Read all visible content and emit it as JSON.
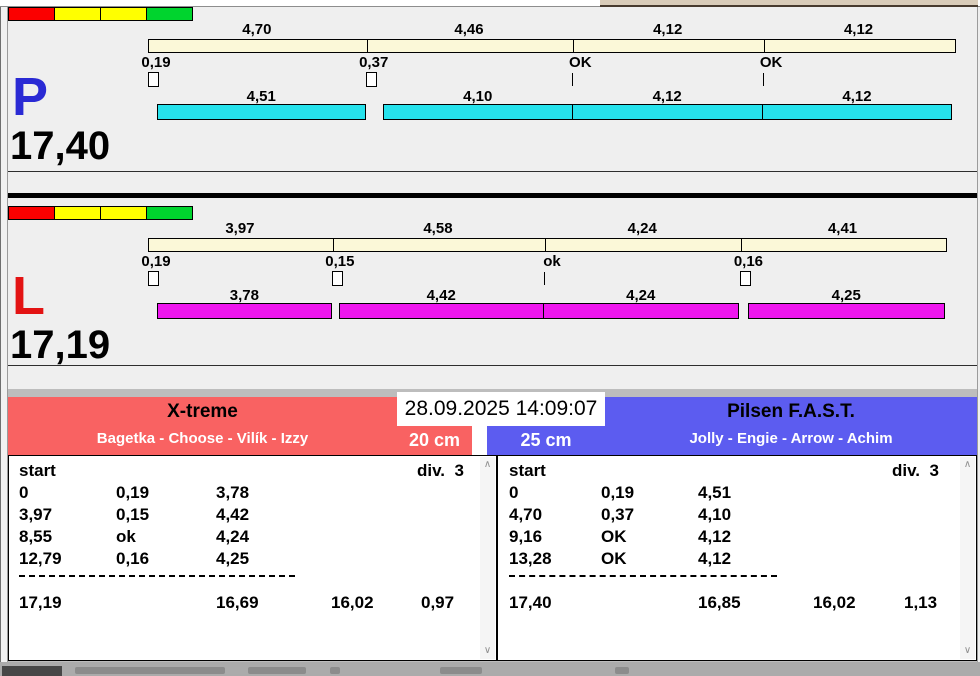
{
  "status_lights": [
    "#fb0000",
    "#ffff00",
    "#ffff00",
    "#00d42e"
  ],
  "datetime": "28.09.2025 14:09:07",
  "lanes": [
    {
      "letter": "P",
      "letter_color": "#2a2ad4",
      "leg_color": "#26e2ec",
      "total": "17,40",
      "splits": [
        {
          "label": "4,70",
          "value": 4.7
        },
        {
          "label": "4,46",
          "value": 4.46
        },
        {
          "label": "4,12",
          "value": 4.12
        },
        {
          "label": "4,12",
          "value": 4.12
        }
      ],
      "markers": [
        {
          "t": 0,
          "label": "0,19",
          "symbol": "box"
        },
        {
          "t": 4.7,
          "label": "0,37",
          "symbol": "box"
        },
        {
          "t": 9.16,
          "label": "OK",
          "symbol": "tick"
        },
        {
          "t": 13.28,
          "label": "OK",
          "symbol": "tick"
        }
      ],
      "legs": [
        {
          "start": 0.19,
          "label": "4,51",
          "value": 4.51,
          "joined": false
        },
        {
          "start": 5.07,
          "label": "4,10",
          "value": 4.1,
          "joined": false
        },
        {
          "start": 9.16,
          "label": "4,12",
          "value": 4.12,
          "joined": true
        },
        {
          "start": 13.28,
          "label": "4,12",
          "value": 4.12,
          "joined": true
        }
      ]
    },
    {
      "letter": "L",
      "letter_color": "#e31313",
      "leg_color": "#ee16ee",
      "total": "17,19",
      "splits": [
        {
          "label": "3,97",
          "value": 3.97
        },
        {
          "label": "4,58",
          "value": 4.58
        },
        {
          "label": "4,24",
          "value": 4.24
        },
        {
          "label": "4,41",
          "value": 4.41
        }
      ],
      "markers": [
        {
          "t": 0,
          "label": "0,19",
          "symbol": "box"
        },
        {
          "t": 3.97,
          "label": "0,15",
          "symbol": "box"
        },
        {
          "t": 8.55,
          "label": "ok",
          "symbol": "tick"
        },
        {
          "t": 12.79,
          "label": "0,16",
          "symbol": "box"
        }
      ],
      "legs": [
        {
          "start": 0.19,
          "label": "3,78",
          "value": 3.78,
          "joined": false
        },
        {
          "start": 4.12,
          "label": "4,42",
          "value": 4.42,
          "joined": false
        },
        {
          "start": 8.55,
          "label": "4,24",
          "value": 4.24,
          "joined": true
        },
        {
          "start": 12.95,
          "label": "4,25",
          "value": 4.25,
          "joined": false
        }
      ]
    }
  ],
  "teams": [
    {
      "name": "X-treme",
      "members": "Bagetka - Choose - Vilík - Izzy",
      "barrier": "20 cm",
      "color": "#f96262"
    },
    {
      "name": "Pilsen F.A.S.T.",
      "members": "Jolly - Engie - Arrow - Achim",
      "barrier": "25 cm",
      "color": "#5c5cf0"
    }
  ],
  "tables": [
    {
      "header": "start",
      "division": "div.  3",
      "rows": [
        [
          "0",
          "0,19",
          "3,78"
        ],
        [
          "3,97",
          "0,15",
          "4,42"
        ],
        [
          "8,55",
          "ok",
          "4,24"
        ],
        [
          "12,79",
          "0,16",
          "4,25"
        ]
      ],
      "totals": [
        "17,19",
        "16,69",
        "16,02",
        "0,97"
      ]
    },
    {
      "header": "start",
      "division": "div.  3",
      "rows": [
        [
          "0",
          "0,19",
          "4,51"
        ],
        [
          "4,70",
          "0,37",
          "4,10"
        ],
        [
          "9,16",
          "OK",
          "4,12"
        ],
        [
          "13,28",
          "OK",
          "4,12"
        ]
      ],
      "totals": [
        "17,40",
        "16,85",
        "16,02",
        "1,13"
      ]
    }
  ],
  "icons": {
    "scroll_up": "∧",
    "scroll_down": "∨"
  }
}
